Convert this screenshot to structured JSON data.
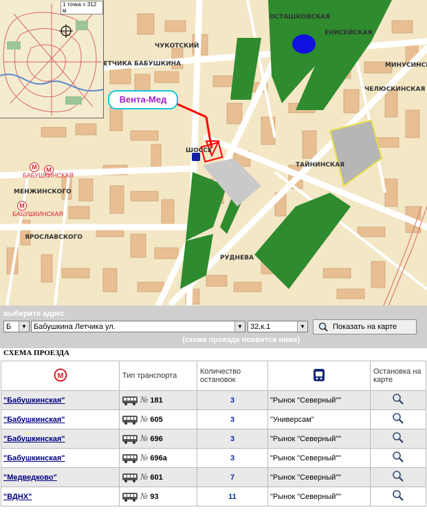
{
  "map": {
    "callout_label": "Вента-Мед",
    "scale_label": "1 точка = 312 м",
    "metro_stations": [
      "БАБУШКИНСКАЯ",
      "БАБУШКИНСКАЯ"
    ],
    "streets": [
      {
        "text": "ЛЕТЧИКА БАБУШКИНА"
      },
      {
        "text": "МЕНЖИНСКОГО"
      },
      {
        "text": "ЕНИСЕЙСКАЯ"
      },
      {
        "text": "ЧУКОТСКИЙ"
      },
      {
        "text": "ЧЕЛЮСКИНСКАЯ"
      },
      {
        "text": "ЯРОСЛАВСКОГО"
      },
      {
        "text": "ОСТАШКОВСКАЯ"
      },
      {
        "text": "МИНУСИНСКАЯ"
      },
      {
        "text": "ТАЙНИНСКАЯ"
      },
      {
        "text": "ШОССЕ"
      },
      {
        "text": "РУДНЕВА"
      }
    ]
  },
  "address_form": {
    "title": "выберите адрес",
    "letter": "Б",
    "street": "Бабушкина Летчика ул.",
    "house": "32,к.1",
    "show_button": "Показать на карте",
    "hint": "(схема проезда появится ниже)"
  },
  "route": {
    "title": "СХЕМА ПРОЕЗДА",
    "headers": {
      "type": "Тип транспорта",
      "count": "Количество остановок",
      "map": "Остановка на карте"
    },
    "num_sign": "№",
    "rows": [
      {
        "metro": "\"Бабушкинская\"",
        "route": "181",
        "stops": "3",
        "stop_name": "\"Рынок \"Северный\"\""
      },
      {
        "metro": "\"Бабушкинская\"",
        "route": "605",
        "stops": "3",
        "stop_name": "\"Универсам\""
      },
      {
        "metro": "\"Бабушкинская\"",
        "route": "696",
        "stops": "3",
        "stop_name": "\"Рынок \"Северный\"\""
      },
      {
        "metro": "\"Бабушкинская\"",
        "route": "696а",
        "stops": "3",
        "stop_name": "\"Рынок \"Северный\"\""
      },
      {
        "metro": "\"Медведково\"",
        "route": "601",
        "stops": "7",
        "stop_name": "\"Рынок \"Северный\"\""
      },
      {
        "metro": "\"ВДНХ\"",
        "route": "93",
        "stops": "11",
        "stop_name": "\"Рынок \"Северный\"\""
      }
    ]
  },
  "colors": {
    "map_bg": "#f3e7c6",
    "building": "#e8bf93",
    "park": "#2e8b2e",
    "water": "#1010e0",
    "marker": "#ff0000",
    "callout_border": "#14c6d8",
    "callout_text": "#a01fc8",
    "metro": "#d8202a"
  }
}
